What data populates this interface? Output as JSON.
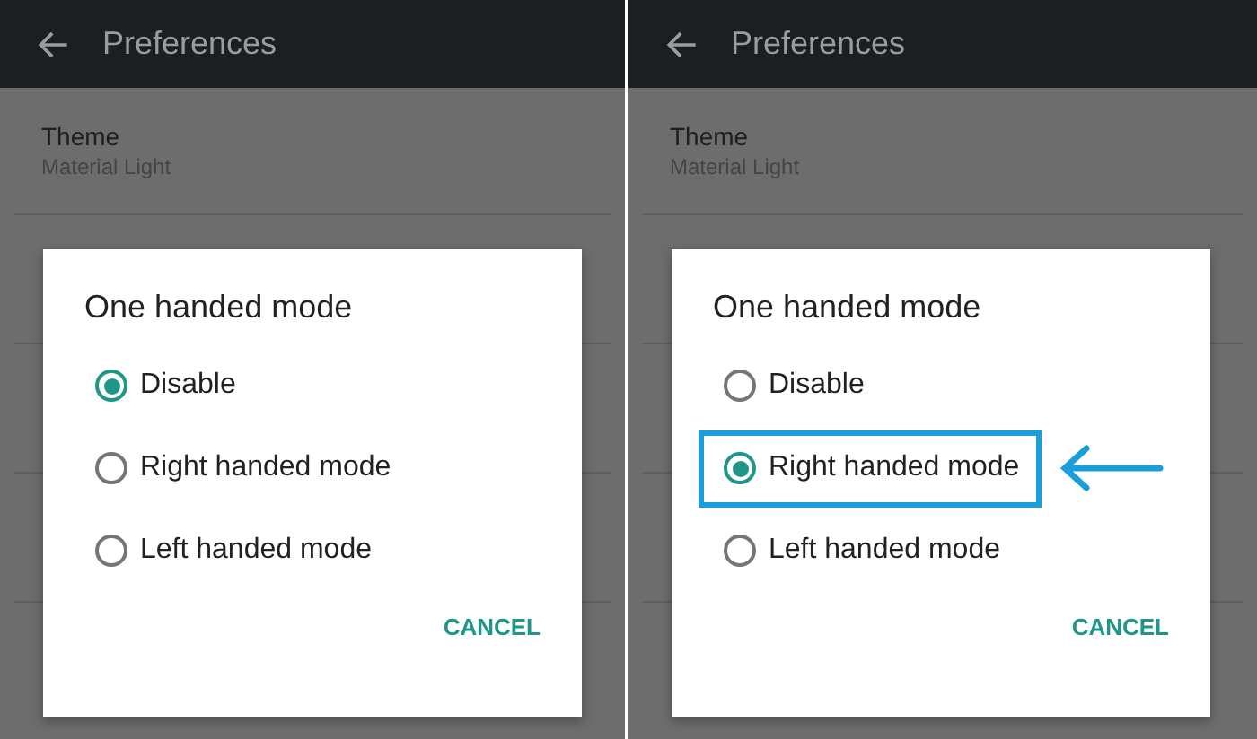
{
  "panels": [
    {
      "header": {
        "title": "Preferences"
      },
      "settings": [
        {
          "title": "Theme",
          "subtitle": "Material Light"
        }
      ],
      "dialog": {
        "title": "One handed mode",
        "options": [
          {
            "label": "Disable",
            "selected": true,
            "highlighted": false
          },
          {
            "label": "Right handed mode",
            "selected": false,
            "highlighted": false
          },
          {
            "label": "Left handed mode",
            "selected": false,
            "highlighted": false
          }
        ],
        "button": "CANCEL"
      }
    },
    {
      "header": {
        "title": "Preferences"
      },
      "settings": [
        {
          "title": "Theme",
          "subtitle": "Material Light"
        }
      ],
      "dialog": {
        "title": "One handed mode",
        "options": [
          {
            "label": "Disable",
            "selected": false,
            "highlighted": false
          },
          {
            "label": "Right handed mode",
            "selected": true,
            "highlighted": true
          },
          {
            "label": "Left handed mode",
            "selected": false,
            "highlighted": false
          }
        ],
        "button": "CANCEL"
      }
    }
  ]
}
